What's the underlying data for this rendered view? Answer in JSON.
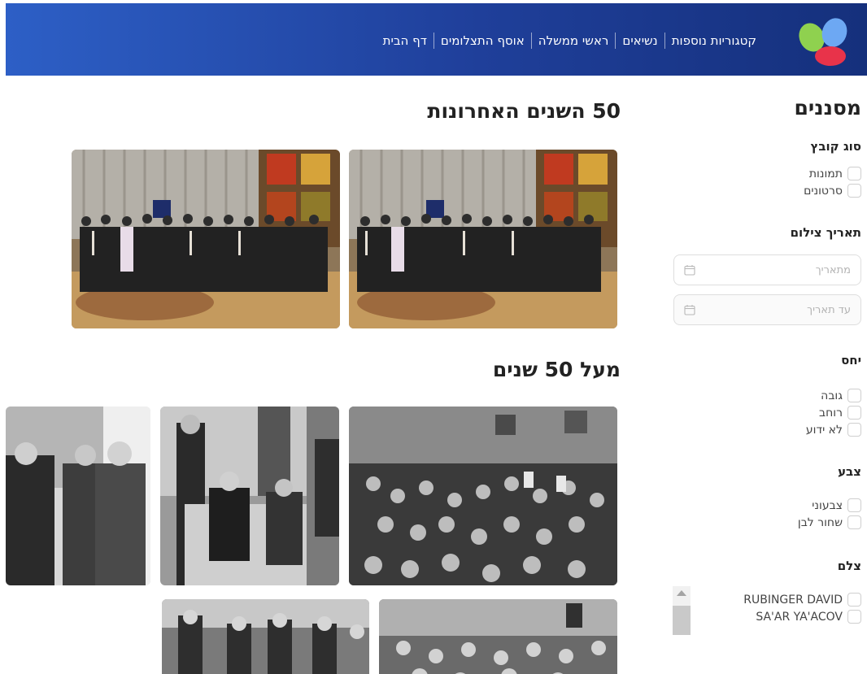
{
  "header": {
    "nav": [
      "דף הבית",
      "אוסף התצלומים",
      "ראשי ממשלה",
      "נשיאים",
      "קטגוריות נוספות"
    ],
    "logo_colors": [
      "#8fd14f",
      "#6da8f3",
      "#e8334a"
    ]
  },
  "filters": {
    "title": "מסננים",
    "file_type": {
      "title": "סוג קובץ",
      "options": [
        "תמונות",
        "סרטונים"
      ]
    },
    "date": {
      "title": "תאריך צילום",
      "from_placeholder": "מתאריך",
      "to_placeholder": "עד תאריך"
    },
    "ratio": {
      "title": "יחס",
      "options": [
        "גובה",
        "רוחב",
        "לא ידוע"
      ]
    },
    "color": {
      "title": "צבע",
      "options": [
        "צבעוני",
        "שחור לבן"
      ]
    },
    "photographer": {
      "title": "צלם",
      "options": [
        "RUBINGER DAVID",
        "SA'AR YA'ACOV"
      ]
    }
  },
  "sections": {
    "recent": {
      "title": "50 השנים האחרונות"
    },
    "older": {
      "title": "מעל 50 שנים"
    }
  }
}
